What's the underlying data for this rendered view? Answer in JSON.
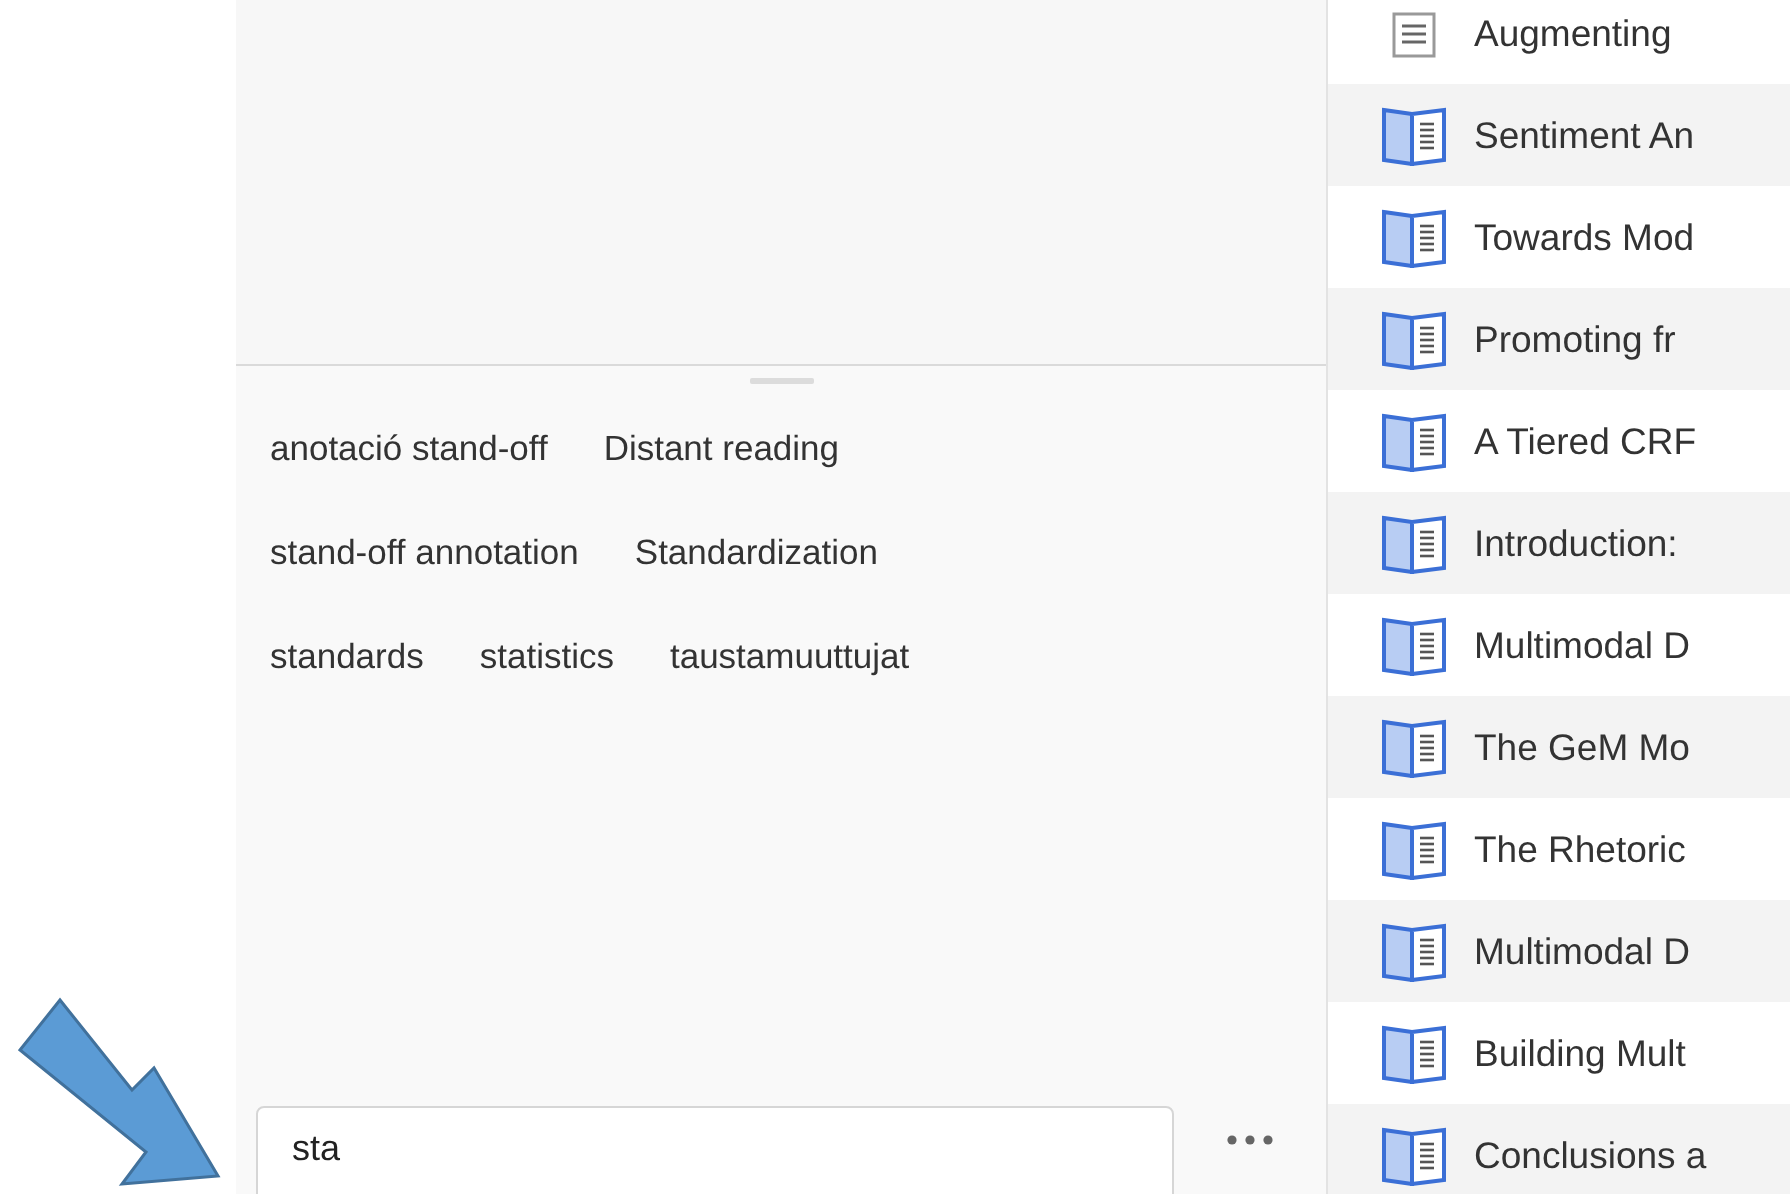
{
  "tag_selector": {
    "tags": [
      "anotació stand-off",
      "Distant reading",
      "stand-off annotation",
      "Standardization",
      "standards",
      "statistics",
      "taustamuuttujat"
    ],
    "filter": {
      "value": "sta"
    }
  },
  "items": [
    {
      "kind": "note",
      "title": "Augmenting"
    },
    {
      "kind": "book",
      "title": "Sentiment An"
    },
    {
      "kind": "book",
      "title": "Towards Mod"
    },
    {
      "kind": "book",
      "title": "Promoting fr"
    },
    {
      "kind": "book",
      "title": "A Tiered CRF"
    },
    {
      "kind": "book",
      "title": "Introduction:"
    },
    {
      "kind": "book",
      "title": "Multimodal D"
    },
    {
      "kind": "book",
      "title": "The GeM Mo"
    },
    {
      "kind": "book",
      "title": "The Rhetoric"
    },
    {
      "kind": "book",
      "title": "Multimodal D"
    },
    {
      "kind": "book",
      "title": "Building Mult"
    },
    {
      "kind": "book",
      "title": "Conclusions a"
    }
  ]
}
